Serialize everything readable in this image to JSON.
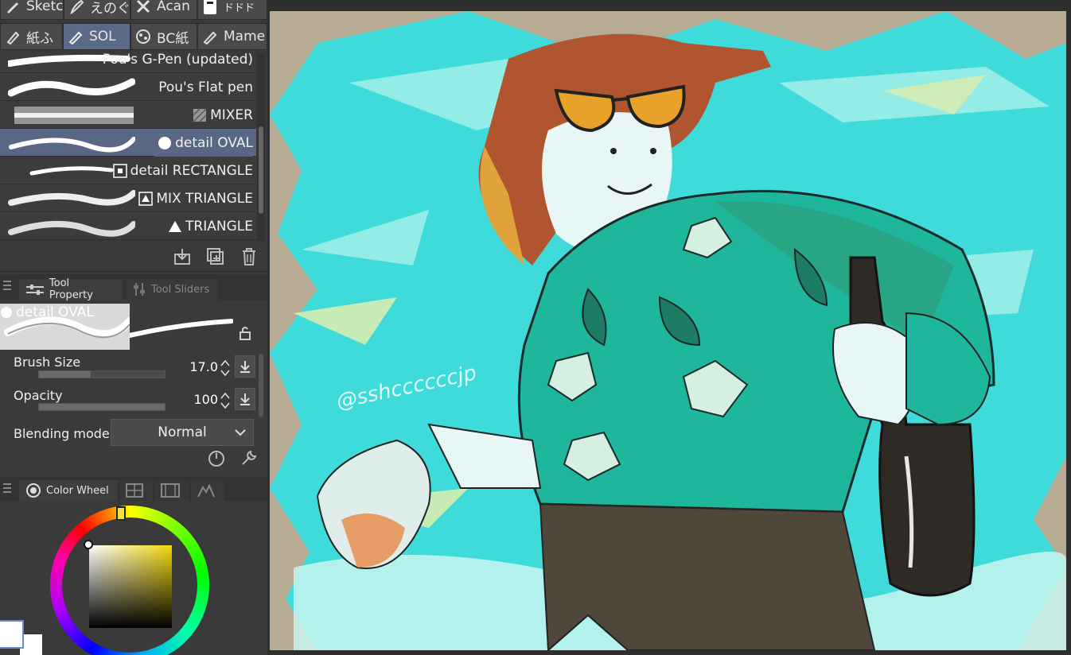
{
  "tool_tabs_row1": [
    {
      "label": "Sketc",
      "icon": "pencil-icon"
    },
    {
      "label": "えのぐ",
      "icon": "brush-icon"
    },
    {
      "label": "Acan",
      "icon": "cross-brush-icon"
    },
    {
      "label": "ドドド",
      "icon": "stamp-icon"
    }
  ],
  "tool_tabs_row2": [
    {
      "label": "紙ふ",
      "icon": "eraser-pen-icon"
    },
    {
      "label": "SOL",
      "icon": "pen-icon"
    },
    {
      "label": "BC紙",
      "icon": "texture-icon"
    },
    {
      "label": "Mame",
      "icon": "marker-icon"
    }
  ],
  "brushes": [
    {
      "name": "Pou's G-Pen (updated)",
      "mark": ""
    },
    {
      "name": "Pou's Flat pen",
      "mark": ""
    },
    {
      "name": "MIXER",
      "mark": "hatched-square-icon"
    },
    {
      "name": "detail OVAL",
      "mark": "circle-icon"
    },
    {
      "name": "detail  RECTANGLE",
      "mark": "square-icon"
    },
    {
      "name": "MIX TRIANGLE",
      "mark": "triangle-outline-icon"
    },
    {
      "name": "TRIANGLE",
      "mark": "triangle-icon"
    }
  ],
  "panel_tabs": {
    "tool_property": "Tool Property",
    "tool_sliders": "Tool Sliders"
  },
  "tool_property": {
    "brush_name": "detail OVAL",
    "brush_size_label": "Brush Size",
    "brush_size_value": "17.0",
    "brush_size_level": 0.41,
    "opacity_label": "Opacity",
    "opacity_value": "100",
    "opacity_level": 1.0,
    "blending_label": "Blending mode",
    "blending_value": "Normal"
  },
  "color_panel": {
    "tab_label": "Color Wheel",
    "current_color": "#f7e534"
  },
  "canvas": {
    "watermark": "@sshccccccjp",
    "background": "#b7ac93"
  }
}
